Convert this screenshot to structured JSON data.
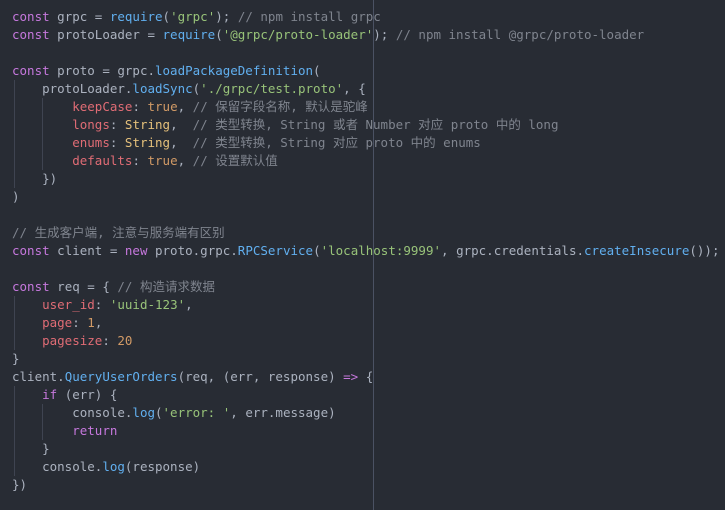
{
  "lines": [
    [
      [
        "kw",
        "const"
      ],
      [
        "pl",
        " grpc = "
      ],
      [
        "fn",
        "require"
      ],
      [
        "pl",
        "("
      ],
      [
        "str",
        "'grpc'"
      ],
      [
        "pl",
        "); "
      ],
      [
        "cm",
        "// npm install grpc"
      ]
    ],
    [
      [
        "kw",
        "const"
      ],
      [
        "pl",
        " protoLoader = "
      ],
      [
        "fn",
        "require"
      ],
      [
        "pl",
        "("
      ],
      [
        "str",
        "'@grpc/proto-loader'"
      ],
      [
        "pl",
        "); "
      ],
      [
        "cm",
        "// npm install @grpc/proto-loader"
      ]
    ],
    [],
    [
      [
        "kw",
        "const"
      ],
      [
        "pl",
        " proto = grpc."
      ],
      [
        "fn",
        "loadPackageDefinition"
      ],
      [
        "pl",
        "("
      ]
    ],
    [
      [
        "pl",
        "    protoLoader."
      ],
      [
        "fn",
        "loadSync"
      ],
      [
        "pl",
        "("
      ],
      [
        "str",
        "'./grpc/test.proto'"
      ],
      [
        "pl",
        ", {"
      ]
    ],
    [
      [
        "pl",
        "        "
      ],
      [
        "key",
        "keepCase"
      ],
      [
        "pl",
        ": "
      ],
      [
        "num",
        "true"
      ],
      [
        "pl",
        ", "
      ],
      [
        "cm",
        "// 保留字段名称, 默认是驼峰"
      ]
    ],
    [
      [
        "pl",
        "        "
      ],
      [
        "key",
        "longs"
      ],
      [
        "pl",
        ": "
      ],
      [
        "prop",
        "String"
      ],
      [
        "pl",
        ",  "
      ],
      [
        "cm",
        "// 类型转换, String 或者 Number 对应 proto 中的 long"
      ]
    ],
    [
      [
        "pl",
        "        "
      ],
      [
        "key",
        "enums"
      ],
      [
        "pl",
        ": "
      ],
      [
        "prop",
        "String"
      ],
      [
        "pl",
        ",  "
      ],
      [
        "cm",
        "// 类型转换, String 对应 proto 中的 enums"
      ]
    ],
    [
      [
        "pl",
        "        "
      ],
      [
        "key",
        "defaults"
      ],
      [
        "pl",
        ": "
      ],
      [
        "num",
        "true"
      ],
      [
        "pl",
        ", "
      ],
      [
        "cm",
        "// 设置默认值"
      ]
    ],
    [
      [
        "pl",
        "    })"
      ]
    ],
    [
      [
        "pl",
        ")"
      ]
    ],
    [],
    [
      [
        "cm",
        "// 生成客户端, 注意与服务端有区别"
      ]
    ],
    [
      [
        "kw",
        "const"
      ],
      [
        "pl",
        " client = "
      ],
      [
        "kw",
        "new"
      ],
      [
        "pl",
        " proto.grpc."
      ],
      [
        "fn",
        "RPCService"
      ],
      [
        "pl",
        "("
      ],
      [
        "str",
        "'localhost:9999'"
      ],
      [
        "pl",
        ", grpc.credentials."
      ],
      [
        "fn",
        "createInsecure"
      ],
      [
        "pl",
        "());"
      ]
    ],
    [],
    [
      [
        "kw",
        "const"
      ],
      [
        "pl",
        " req = { "
      ],
      [
        "cm",
        "// 构造请求数据"
      ]
    ],
    [
      [
        "pl",
        "    "
      ],
      [
        "key",
        "user_id"
      ],
      [
        "pl",
        ": "
      ],
      [
        "str",
        "'uuid-123'"
      ],
      [
        "pl",
        ","
      ]
    ],
    [
      [
        "pl",
        "    "
      ],
      [
        "key",
        "page"
      ],
      [
        "pl",
        ": "
      ],
      [
        "num",
        "1"
      ],
      [
        "pl",
        ","
      ]
    ],
    [
      [
        "pl",
        "    "
      ],
      [
        "key",
        "pagesize"
      ],
      [
        "pl",
        ": "
      ],
      [
        "num",
        "20"
      ]
    ],
    [
      [
        "pl",
        "}"
      ]
    ],
    [
      [
        "pl",
        "client."
      ],
      [
        "fn",
        "QueryUserOrders"
      ],
      [
        "pl",
        "(req, (err, response) "
      ],
      [
        "kw",
        "=>"
      ],
      [
        "pl",
        " {"
      ]
    ],
    [
      [
        "pl",
        "    "
      ],
      [
        "kw",
        "if"
      ],
      [
        "pl",
        " (err) {"
      ]
    ],
    [
      [
        "pl",
        "        console."
      ],
      [
        "fn",
        "log"
      ],
      [
        "pl",
        "("
      ],
      [
        "str",
        "'error: '"
      ],
      [
        "pl",
        ", err.message)"
      ]
    ],
    [
      [
        "pl",
        "        "
      ],
      [
        "kw",
        "return"
      ]
    ],
    [
      [
        "pl",
        "    }"
      ]
    ],
    [
      [
        "pl",
        "    console."
      ],
      [
        "fn",
        "log"
      ],
      [
        "pl",
        "(response)"
      ]
    ],
    [
      [
        "pl",
        "})"
      ]
    ]
  ]
}
